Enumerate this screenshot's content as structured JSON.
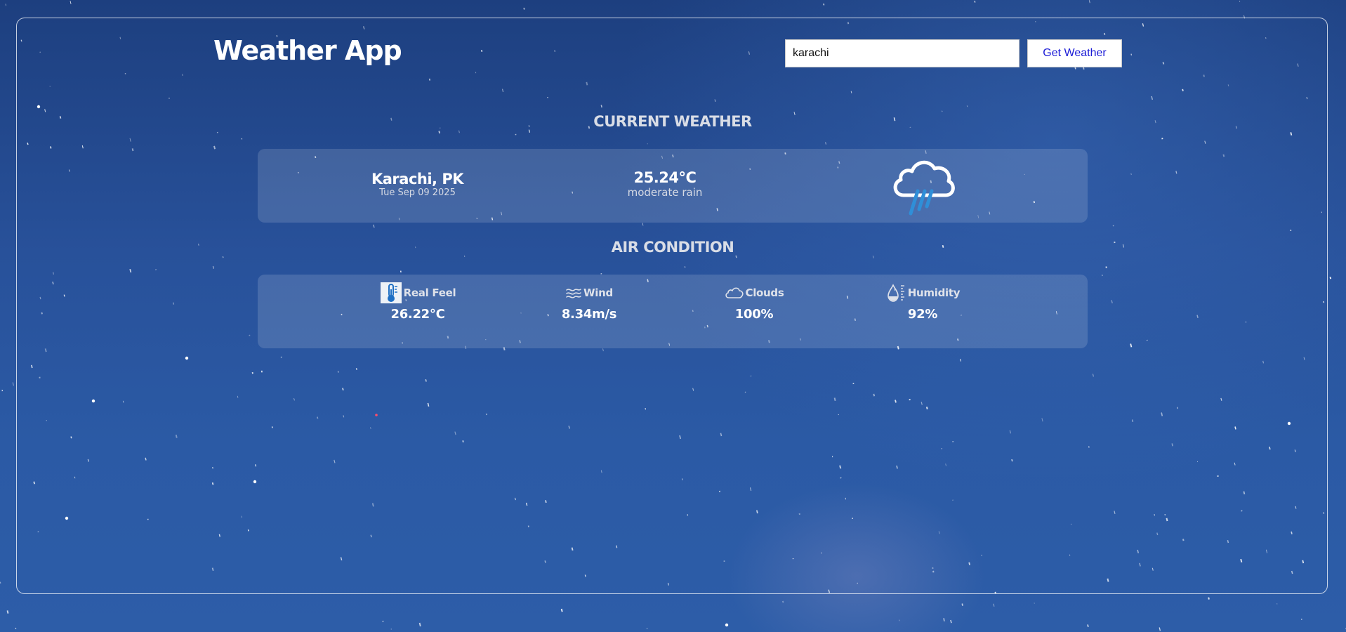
{
  "app": {
    "title": "Weather App"
  },
  "search": {
    "value": "karachi",
    "button_label": "Get Weather"
  },
  "current": {
    "heading": "CURRENT WEATHER",
    "location": "Karachi, PK",
    "date": "Tue Sep 09 2025",
    "temperature": "25.24°C",
    "description": "moderate rain",
    "icon": "rain-cloud-icon"
  },
  "air": {
    "heading": "AIR CONDITION",
    "items": [
      {
        "label": "Real Feel",
        "value": "26.22°C",
        "icon": "thermometer-icon"
      },
      {
        "label": "Wind",
        "value": "8.34m/s",
        "icon": "wind-icon"
      },
      {
        "label": "Clouds",
        "value": "100%",
        "icon": "cloud-icon"
      },
      {
        "label": "Humidity",
        "value": "92%",
        "icon": "humidity-icon"
      }
    ]
  },
  "colors": {
    "background": "#28519a",
    "card": "rgba(255,255,255,0.14)",
    "button_text": "#1a1ad6",
    "rain_accent": "#2f8fd8"
  }
}
